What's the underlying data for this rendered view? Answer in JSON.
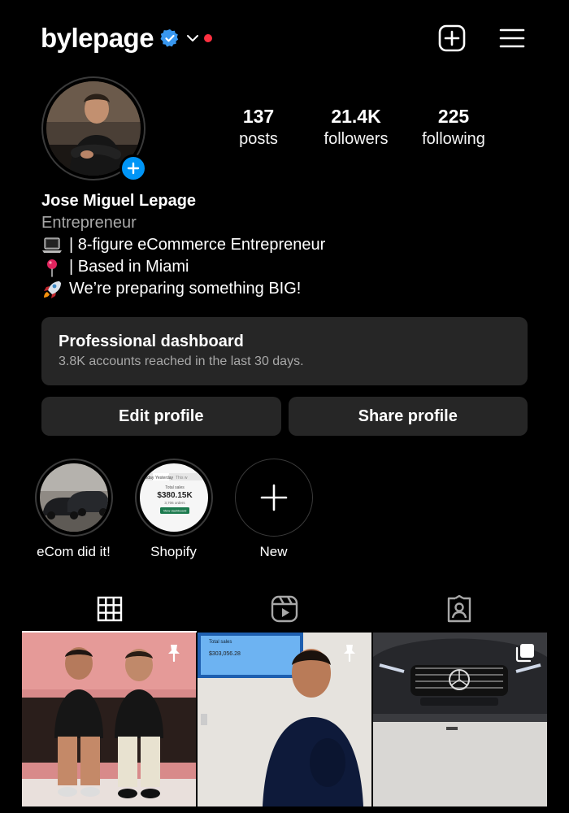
{
  "header": {
    "username": "bylepage",
    "icons": [
      "verified-badge-icon",
      "chevron-down-icon",
      "notification-dot",
      "new-post-icon",
      "menu-icon"
    ]
  },
  "profile": {
    "stats": [
      {
        "value": "137",
        "label": "posts"
      },
      {
        "value": "21.4K",
        "label": "followers"
      },
      {
        "value": "225",
        "label": "following"
      }
    ],
    "name": "Jose Miguel Lepage",
    "category": "Entrepreneur",
    "bio": [
      {
        "icon": "laptop-emoji",
        "text": "| 8-figure eCommerce Entrepreneur"
      },
      {
        "icon": "pin-emoji",
        "text": "| Based in Miami"
      },
      {
        "icon": "rocket-emoji",
        "text": "We’re preparing something BIG!"
      }
    ]
  },
  "dashboard": {
    "title": "Professional dashboard",
    "subtitle": "3.8K accounts reached in the last 30 days."
  },
  "buttons": {
    "edit": "Edit profile",
    "share": "Share profile"
  },
  "highlights": [
    {
      "label": "eCom did it!"
    },
    {
      "label": "Shopify",
      "tabs": [
        "Today",
        "Yesterday",
        "This w"
      ],
      "caption": "Total sales",
      "amount": "$380.15K",
      "orders": "3,706 orders",
      "cta": "View dashboard"
    },
    {
      "label": "New"
    }
  ],
  "tabs": [
    "grid-icon",
    "reels-icon",
    "tagged-icon"
  ],
  "posts": [
    {
      "icon": "pin-icon"
    },
    {
      "icon": "pin-icon",
      "screen_caption": "Total sales",
      "screen_amount": "$303,056.28"
    },
    {
      "icon": "carousel-icon"
    }
  ],
  "colors": {
    "accent": "#0095f6",
    "surface": "#262626",
    "muted": "#a8a8a8",
    "notification": "#ff3040"
  }
}
